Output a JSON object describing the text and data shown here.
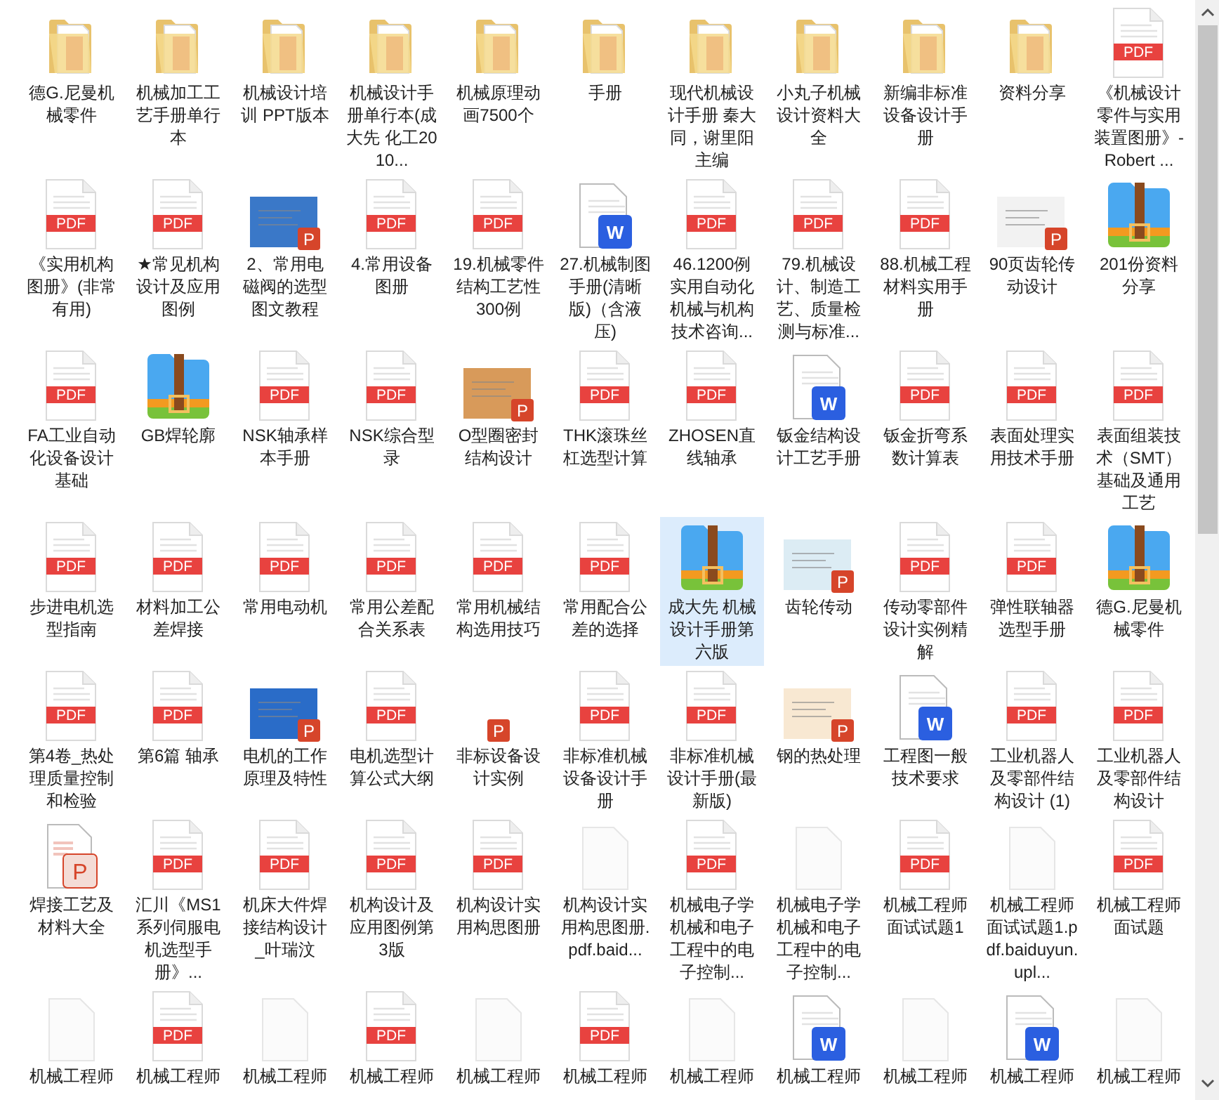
{
  "items": [
    {
      "kind": "folder",
      "label": "德G.尼曼机械零件",
      "selected": false
    },
    {
      "kind": "folder",
      "label": "机械加工工艺手册单行本",
      "selected": false
    },
    {
      "kind": "folder",
      "label": "机械设计培训 PPT版本",
      "selected": false
    },
    {
      "kind": "folder",
      "label": "机械设计手册单行本(成大先 化工2010...",
      "selected": false
    },
    {
      "kind": "folder",
      "label": "机械原理动画7500个",
      "selected": false
    },
    {
      "kind": "folder",
      "label": "手册",
      "selected": false
    },
    {
      "kind": "folder",
      "label": "现代机械设计手册  秦大同，谢里阳主编",
      "selected": false
    },
    {
      "kind": "folder",
      "label": "小丸子机械设计资料大全",
      "selected": false
    },
    {
      "kind": "folder",
      "label": "新编非标准设备设计手册",
      "selected": false
    },
    {
      "kind": "folder",
      "label": "资料分享",
      "selected": false
    },
    {
      "kind": "pdf",
      "badge": "PDF",
      "label": "《机械设计零件与实用装置图册》-Robert ...",
      "selected": false
    },
    {
      "kind": "pdf",
      "badge": "PDF",
      "label": "《实用机构图册》(非常有用)",
      "selected": false
    },
    {
      "kind": "pdf",
      "badge": "PDF",
      "label": "★常见机构设计及应用图例",
      "selected": false
    },
    {
      "kind": "slide",
      "badge": "P",
      "color": "#3a78c8",
      "label": "2、常用电磁阀的选型图文教程",
      "selected": false
    },
    {
      "kind": "pdf",
      "badge": "PDF",
      "label": "4.常用设备图册",
      "selected": false
    },
    {
      "kind": "pdf",
      "badge": "PDF",
      "label": "19.机械零件结构工艺性300例",
      "selected": false
    },
    {
      "kind": "word",
      "badge": "W",
      "label": "27.机械制图手册(清晰版)（含液压)",
      "selected": false
    },
    {
      "kind": "pdf",
      "badge": "PDF",
      "label": "46.1200例实用自动化机械与机构技术咨询...",
      "selected": false
    },
    {
      "kind": "pdf",
      "badge": "PDF",
      "label": "79.机械设计、制造工艺、质量检测与标准...",
      "selected": false
    },
    {
      "kind": "pdf",
      "badge": "PDF",
      "label": "88.机械工程材料实用手册",
      "selected": false
    },
    {
      "kind": "slide",
      "badge": "P",
      "color": "#f2f2f2",
      "label": "90页齿轮传动设计",
      "selected": false
    },
    {
      "kind": "zip",
      "label": "201份资料分享",
      "selected": false
    },
    {
      "kind": "pdf",
      "badge": "PDF",
      "label": "FA工业自动化设备设计基础",
      "selected": false
    },
    {
      "kind": "zip",
      "label": "GB焊轮廓",
      "selected": false
    },
    {
      "kind": "pdf",
      "badge": "PDF",
      "label": "NSK轴承样本手册",
      "selected": false
    },
    {
      "kind": "pdf",
      "badge": "PDF",
      "label": "NSK综合型录",
      "selected": false
    },
    {
      "kind": "slide",
      "badge": "P",
      "color": "#d89a5a",
      "label": "O型圈密封结构设计",
      "selected": false
    },
    {
      "kind": "pdf",
      "badge": "PDF",
      "label": "THK滚珠丝杠选型计算",
      "selected": false
    },
    {
      "kind": "pdf",
      "badge": "PDF",
      "label": "ZHOSEN直线轴承",
      "selected": false
    },
    {
      "kind": "word",
      "badge": "W",
      "label": "钣金结构设计工艺手册",
      "selected": false
    },
    {
      "kind": "pdf",
      "badge": "PDF",
      "label": "钣金折弯系数计算表",
      "selected": false
    },
    {
      "kind": "pdf",
      "badge": "PDF",
      "label": "表面处理实用技术手册",
      "selected": false
    },
    {
      "kind": "pdf",
      "badge": "PDF",
      "label": "表面组装技术（SMT）基础及通用工艺",
      "selected": false
    },
    {
      "kind": "pdf",
      "badge": "PDF",
      "label": "步进电机选型指南",
      "selected": false
    },
    {
      "kind": "pdf",
      "badge": "PDF",
      "label": "材料加工公差焊接",
      "selected": false
    },
    {
      "kind": "pdf",
      "badge": "PDF",
      "label": "常用电动机",
      "selected": false
    },
    {
      "kind": "pdf",
      "badge": "PDF",
      "label": "常用公差配合关系表",
      "selected": false
    },
    {
      "kind": "pdf",
      "badge": "PDF",
      "label": "常用机械结构选用技巧",
      "selected": false
    },
    {
      "kind": "pdf",
      "badge": "PDF",
      "label": "常用配合公差的选择",
      "selected": false
    },
    {
      "kind": "zip",
      "label": "成大先 机械设计手册第六版",
      "selected": true
    },
    {
      "kind": "slide",
      "badge": "P",
      "color": "#dcecf4",
      "label": "齿轮传动",
      "selected": false
    },
    {
      "kind": "pdf",
      "badge": "PDF",
      "label": "传动零部件设计实例精解",
      "selected": false
    },
    {
      "kind": "pdf",
      "badge": "PDF",
      "label": "弹性联轴器选型手册",
      "selected": false
    },
    {
      "kind": "zip",
      "label": "德G.尼曼机械零件",
      "selected": false
    },
    {
      "kind": "pdf",
      "badge": "PDF",
      "label": "第4卷_热处理质量控制和检验",
      "selected": false
    },
    {
      "kind": "pdf",
      "badge": "PDF",
      "label": "第6篇 轴承",
      "selected": false
    },
    {
      "kind": "slide",
      "badge": "P",
      "color": "#2a6cc8",
      "label": "电机的工作原理及特性",
      "selected": false
    },
    {
      "kind": "pdf",
      "badge": "PDF",
      "label": "电机选型计算公式大纲",
      "selected": false
    },
    {
      "kind": "ppt-badge",
      "badge": "P",
      "label": "非标设备设计实例",
      "selected": false
    },
    {
      "kind": "pdf",
      "badge": "PDF",
      "label": "非标准机械设备设计手册",
      "selected": false
    },
    {
      "kind": "pdf",
      "badge": "PDF",
      "label": "非标准机械设计手册(最新版)",
      "selected": false
    },
    {
      "kind": "slide",
      "badge": "P",
      "color": "#f8e8d2",
      "label": "钢的热处理",
      "selected": false
    },
    {
      "kind": "word",
      "badge": "W",
      "label": "工程图一般技术要求",
      "selected": false
    },
    {
      "kind": "pdf",
      "badge": "PDF",
      "label": "工业机器人及零部件结构设计 (1)",
      "selected": false
    },
    {
      "kind": "pdf",
      "badge": "PDF",
      "label": "工业机器人及零部件结构设计",
      "selected": false
    },
    {
      "kind": "ppt",
      "badge": "P",
      "label": "焊接工艺及材料大全",
      "selected": false
    },
    {
      "kind": "pdf",
      "badge": "PDF",
      "label": "汇川《MS1系列伺服电机选型手册》...",
      "selected": false
    },
    {
      "kind": "pdf",
      "badge": "PDF",
      "label": "机床大件焊接结构设计_叶瑞汶",
      "selected": false
    },
    {
      "kind": "pdf",
      "badge": "PDF",
      "label": "机构设计及应用图例第3版",
      "selected": false
    },
    {
      "kind": "pdf",
      "badge": "PDF",
      "label": "机构设计实用构思图册",
      "selected": false
    },
    {
      "kind": "blank",
      "label": "机构设计实用构思图册.pdf.baid...",
      "selected": false
    },
    {
      "kind": "pdf",
      "badge": "PDF",
      "label": "机械电子学机械和电子工程中的电子控制...",
      "selected": false
    },
    {
      "kind": "blank",
      "label": "机械电子学机械和电子工程中的电子控制...",
      "selected": false
    },
    {
      "kind": "pdf",
      "badge": "PDF",
      "label": "机械工程师面试试题1",
      "selected": false
    },
    {
      "kind": "blank",
      "label": "机械工程师面试试题1.pdf.baiduyun.upl...",
      "selected": false
    },
    {
      "kind": "pdf",
      "badge": "PDF",
      "label": "机械工程师面试题",
      "selected": false
    },
    {
      "kind": "blank",
      "label": "机械工程师",
      "selected": false
    },
    {
      "kind": "pdf",
      "badge": "PDF",
      "label": "机械工程师",
      "selected": false
    },
    {
      "kind": "blank",
      "label": "机械工程师",
      "selected": false
    },
    {
      "kind": "pdf",
      "badge": "PDF",
      "label": "机械工程师",
      "selected": false
    },
    {
      "kind": "blank",
      "label": "机械工程师",
      "selected": false
    },
    {
      "kind": "pdf",
      "badge": "PDF",
      "label": "机械工程师",
      "selected": false
    },
    {
      "kind": "blank",
      "label": "机械工程师",
      "selected": false
    },
    {
      "kind": "word",
      "badge": "W",
      "label": "机械工程师",
      "selected": false
    },
    {
      "kind": "blank",
      "label": "机械工程师",
      "selected": false
    },
    {
      "kind": "word",
      "badge": "W",
      "label": "机械工程师",
      "selected": false
    },
    {
      "kind": "blank",
      "label": "机械工程师",
      "selected": false
    }
  ]
}
